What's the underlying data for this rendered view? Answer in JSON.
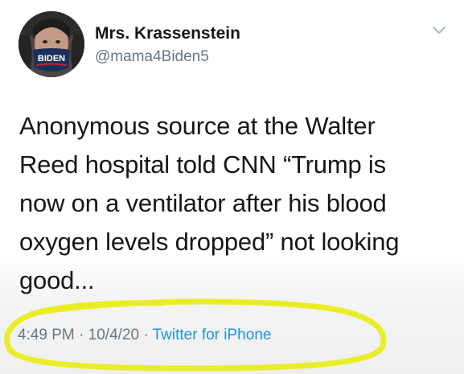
{
  "author": {
    "display_name": "Mrs. Krassenstein",
    "handle": "@mama4Biden5",
    "avatar_mask_text": "BIDEN"
  },
  "tweet": {
    "lines": [
      "Anonymous source at the Walter",
      "Reed hospital told CNN “Trump is",
      "now on a ventilator after his blood",
      "oxygen levels dropped” not looking",
      "good..."
    ]
  },
  "meta": {
    "time": "4:49 PM",
    "separator": "·",
    "date": "10/4/20",
    "source": "Twitter for iPhone"
  },
  "icons": {
    "menu": "chevron-down-icon"
  },
  "colors": {
    "text": "#14171a",
    "secondary": "#657786",
    "link": "#1b95e0",
    "highlight": "#e8ec1e"
  }
}
